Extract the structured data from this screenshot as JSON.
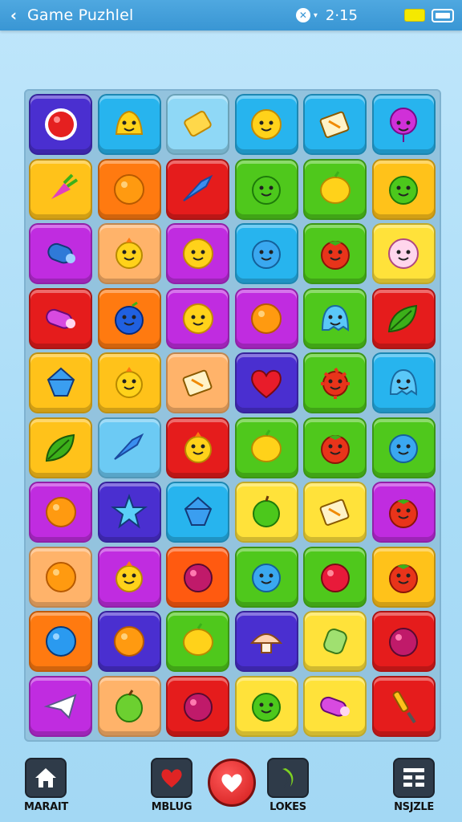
{
  "header": {
    "back_label": "‹",
    "title": "Game Puzhlel",
    "clock": "2·15",
    "close_glyph": "✕",
    "caret_glyph": "▾",
    "accent_color": "#3996d4"
  },
  "board": {
    "rows": 10,
    "cols": 6,
    "tiles": [
      {
        "color": "#4a2fd0",
        "icon": "red-button-icon"
      },
      {
        "color": "#27b4ee",
        "icon": "bell-icon"
      },
      {
        "color": "#8fd8f6",
        "icon": "butter-icon"
      },
      {
        "color": "#27b4ee",
        "icon": "smiley-icon"
      },
      {
        "color": "#27b4ee",
        "icon": "book-icon"
      },
      {
        "color": "#27b4ee",
        "icon": "balloon-icon"
      },
      {
        "color": "#ffc21a",
        "icon": "radish-icon"
      },
      {
        "color": "#ff7a10",
        "icon": "orange-icon"
      },
      {
        "color": "#e51c1c",
        "icon": "fish-icon"
      },
      {
        "color": "#4fc81c",
        "icon": "green-blob-icon"
      },
      {
        "color": "#4fc81c",
        "icon": "lemon-icon"
      },
      {
        "color": "#ffc21a",
        "icon": "green-blob-icon"
      },
      {
        "color": "#c02ce0",
        "icon": "scroll-icon"
      },
      {
        "color": "#ffb36a",
        "icon": "chick-icon"
      },
      {
        "color": "#c02ce0",
        "icon": "smiley-icon"
      },
      {
        "color": "#27b4ee",
        "icon": "blue-blob-icon"
      },
      {
        "color": "#4fc81c",
        "icon": "tomato-icon"
      },
      {
        "color": "#ffe23a",
        "icon": "flower-icon"
      },
      {
        "color": "#e51c1c",
        "icon": "roll-icon"
      },
      {
        "color": "#ff7a10",
        "icon": "blueberry-icon"
      },
      {
        "color": "#c02ce0",
        "icon": "smiley-icon"
      },
      {
        "color": "#c02ce0",
        "icon": "orange-icon"
      },
      {
        "color": "#4fc81c",
        "icon": "ghost-icon"
      },
      {
        "color": "#e51c1c",
        "icon": "leaf-icon"
      },
      {
        "color": "#ffc21a",
        "icon": "gem-icon"
      },
      {
        "color": "#ffc21a",
        "icon": "chick-icon"
      },
      {
        "color": "#ffb36a",
        "icon": "book-icon"
      },
      {
        "color": "#4a2fd0",
        "icon": "heart-icon"
      },
      {
        "color": "#4fc81c",
        "icon": "spiky-fruit-icon"
      },
      {
        "color": "#27b4ee",
        "icon": "ghost-icon"
      },
      {
        "color": "#ffc21a",
        "icon": "leaf-icon"
      },
      {
        "color": "#6ccaf4",
        "icon": "fish-icon"
      },
      {
        "color": "#e51c1c",
        "icon": "chick-icon"
      },
      {
        "color": "#4fc81c",
        "icon": "lemon-icon"
      },
      {
        "color": "#4fc81c",
        "icon": "tomato-icon"
      },
      {
        "color": "#4fc81c",
        "icon": "blue-blob-icon"
      },
      {
        "color": "#c02ce0",
        "icon": "orange-icon"
      },
      {
        "color": "#4a2fd0",
        "icon": "star-icon"
      },
      {
        "color": "#27b4ee",
        "icon": "gem-icon"
      },
      {
        "color": "#ffe23a",
        "icon": "apple-icon"
      },
      {
        "color": "#ffe23a",
        "icon": "book-icon"
      },
      {
        "color": "#c02ce0",
        "icon": "tomato-icon"
      },
      {
        "color": "#ffb36a",
        "icon": "orange-icon"
      },
      {
        "color": "#c02ce0",
        "icon": "chick-icon"
      },
      {
        "color": "#ff5a10",
        "icon": "plum-icon"
      },
      {
        "color": "#4fc81c",
        "icon": "blue-blob-icon"
      },
      {
        "color": "#4fc81c",
        "icon": "berry-icon"
      },
      {
        "color": "#ffc21a",
        "icon": "tomato-icon"
      },
      {
        "color": "#ff7a10",
        "icon": "blue-ball-icon"
      },
      {
        "color": "#4a2fd0",
        "icon": "orange-icon"
      },
      {
        "color": "#4fc81c",
        "icon": "lemon-icon"
      },
      {
        "color": "#4a2fd0",
        "icon": "mushroom-icon"
      },
      {
        "color": "#ffe23a",
        "icon": "glove-icon"
      },
      {
        "color": "#e51c1c",
        "icon": "plum-icon"
      },
      {
        "color": "#c02ce0",
        "icon": "plane-icon"
      },
      {
        "color": "#ffb36a",
        "icon": "lime-icon"
      },
      {
        "color": "#e51c1c",
        "icon": "plum-icon"
      },
      {
        "color": "#ffe23a",
        "icon": "green-blob-icon"
      },
      {
        "color": "#ffe23a",
        "icon": "roll-icon"
      },
      {
        "color": "#e51c1c",
        "icon": "screwdriver-icon"
      }
    ]
  },
  "nav": {
    "items": [
      {
        "label": "MARAIT",
        "icon": "home-icon"
      },
      {
        "label": "MBLUG",
        "icon": "heart-icon"
      },
      {
        "label": "LOKES",
        "icon": "banana-icon"
      },
      {
        "label": "NSJZLE",
        "icon": "grid-icon"
      }
    ],
    "center_icon": "heart-icon"
  }
}
